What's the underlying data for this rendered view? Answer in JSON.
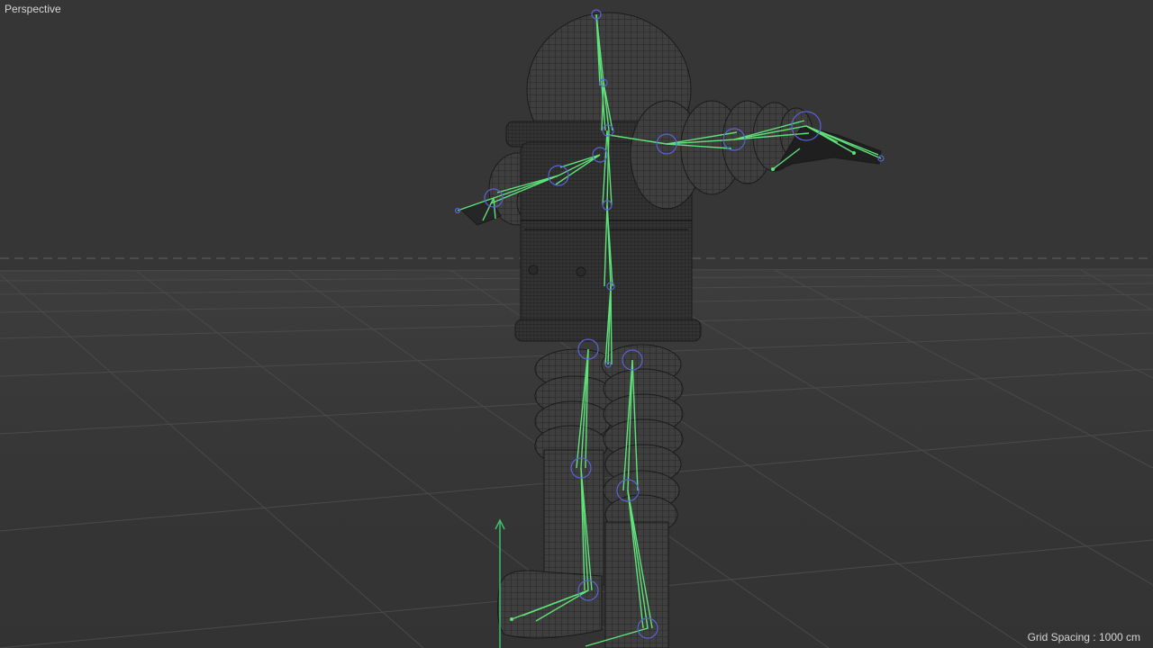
{
  "viewport": {
    "view_name": "Perspective",
    "grid_spacing_text": "Grid Spacing : 1000 cm"
  },
  "colors": {
    "background": "#363636",
    "grid_line": "#4a4a4a",
    "mesh_wire": "#1e1e1e",
    "bone": "#5fe37a",
    "joint": "#5a62d8",
    "axis_y": "#3fbf6a"
  },
  "scene": {
    "object": "character-mesh",
    "rig": "skeleton",
    "axis_icon": "y-axis-arrow-icon"
  }
}
